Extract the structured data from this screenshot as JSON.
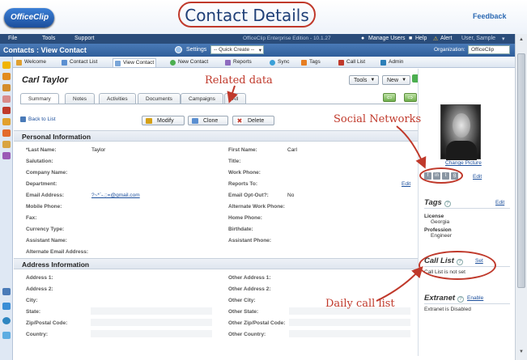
{
  "banner": {
    "logo_text": "OfficeClip",
    "page_heading": "Contact Details",
    "feedback": "Feedback"
  },
  "menubar": {
    "items": [
      "File",
      "Tools",
      "Support"
    ],
    "edition": "OfficeClip Enterprise Edition - 10.1.27",
    "manage_users": "Manage Users",
    "help": "Help",
    "alert": "Alert",
    "user": "User, Sample"
  },
  "titlebar": {
    "title": "Contacts : View Contact",
    "settings": "Settings",
    "quick_create": "-- Quick Create --",
    "organization_label": "Organization:",
    "organization_value": "OfficeClip"
  },
  "toolbar": {
    "tabs": [
      "Welcome",
      "Contact List",
      "View Contact",
      "New Contact",
      "Reports",
      "Sync",
      "Tags",
      "Call List",
      "Admin"
    ],
    "active_index": 2
  },
  "contact": {
    "name": "Carl Taylor",
    "tools_label": "Tools",
    "new_label": "New"
  },
  "subtabs": {
    "items": [
      "Summary",
      "Notes",
      "Activities",
      "Documents",
      "Campaigns",
      "All"
    ],
    "active_index": 0
  },
  "actions": {
    "back": "Back to List",
    "modify": "Modify",
    "clone": "Clone",
    "delete": "Delete"
  },
  "personal": {
    "header": "Personal Information",
    "left": [
      {
        "label": "*Last Name:",
        "value": "Taylor"
      },
      {
        "label": "Salutation:",
        "value": ""
      },
      {
        "label": "Company Name:",
        "value": ""
      },
      {
        "label": "Department:",
        "value": ""
      },
      {
        "label": "Email Address:",
        "value": "?~*`-.;:=@gmail.com"
      },
      {
        "label": "Mobile Phone:",
        "value": ""
      },
      {
        "label": "Fax:",
        "value": ""
      },
      {
        "label": "Currency Type:",
        "value": ""
      },
      {
        "label": "Assistant Name:",
        "value": ""
      },
      {
        "label": "Alternate Email Address:",
        "value": ""
      }
    ],
    "right": [
      {
        "label": "First Name:",
        "value": "Carl"
      },
      {
        "label": "Title:",
        "value": ""
      },
      {
        "label": "Work Phone:",
        "value": ""
      },
      {
        "label": "Reports To:",
        "value": ""
      },
      {
        "label": "Email Opt-Out?:",
        "value": "No"
      },
      {
        "label": "Alternate Work Phone:",
        "value": ""
      },
      {
        "label": "Home Phone:",
        "value": ""
      },
      {
        "label": "Birthdate:",
        "value": ""
      },
      {
        "label": "Assistant Phone:",
        "value": ""
      }
    ],
    "reports_edit": "Edit"
  },
  "address": {
    "header": "Address Information",
    "left": [
      "Address 1:",
      "Address 2:",
      "City:",
      "State:",
      "Zip/Postal Code:",
      "Country:"
    ],
    "right": [
      "Other Address 1:",
      "Other Address 2:",
      "Other City:",
      "Other State:",
      "Other Zip/Postal Code:",
      "Other Country:"
    ]
  },
  "rightpanel": {
    "change_picture": "Change Picture",
    "social_edit": "Edit",
    "social_icons": [
      "facebook-icon",
      "linkedin-icon",
      "twitter-icon",
      "googleplus-icon"
    ],
    "tags": {
      "header": "Tags",
      "edit": "Edit",
      "license_label": "License",
      "license_value": "Georgia",
      "profession_label": "Profession",
      "profession_value": "Engineer"
    },
    "call_list": {
      "header": "Call List",
      "set": "Set",
      "status": "Call List is not set"
    },
    "extranet": {
      "header": "Extranet",
      "enable": "Enable",
      "status": "Extranet is Disabled"
    }
  },
  "annotations": {
    "related_data": "Related data",
    "social_networks": "Social Networks",
    "daily_call_list": "Daily call list"
  },
  "colors": {
    "accent": "#2f5d99",
    "annotation": "#c0392b",
    "link": "#1c4f9c"
  }
}
